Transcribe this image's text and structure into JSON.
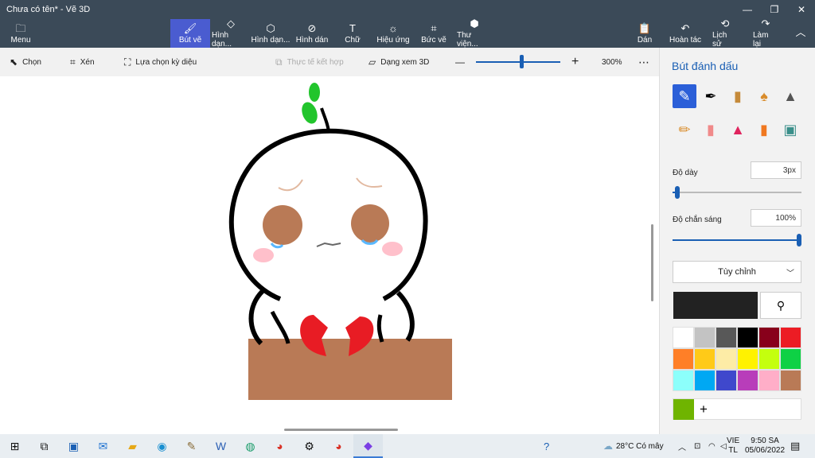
{
  "window": {
    "title": "Chưa có tên* - Vẽ 3D",
    "controls": {
      "minimize": "—",
      "restore": "❐",
      "close": "✕"
    }
  },
  "ribbon": {
    "menu": {
      "label": "Menu",
      "icon": "folder-icon"
    },
    "tabs": [
      {
        "label": "Bút vẽ",
        "icon": "brush-icon",
        "active": true
      },
      {
        "label": "Hình dạn...",
        "icon": "shapes2d-icon"
      },
      {
        "label": "Hình dạn...",
        "icon": "shapes3d-icon"
      },
      {
        "label": "Hình dán",
        "icon": "sticker-icon"
      },
      {
        "label": "Chữ",
        "icon": "text-icon"
      },
      {
        "label": "Hiệu ứng",
        "icon": "effects-icon"
      },
      {
        "label": "Bức vẽ",
        "icon": "canvas-icon"
      },
      {
        "label": "Thư viện...",
        "icon": "library-icon"
      }
    ],
    "right": [
      {
        "label": "Dán",
        "icon": "paste-icon"
      },
      {
        "label": "Hoàn tác",
        "icon": "undo-icon"
      },
      {
        "label": "Lịch sử",
        "icon": "history-icon"
      },
      {
        "label": "Làm lại",
        "icon": "redo-icon"
      }
    ],
    "collapse_icon": "chevron-up-icon"
  },
  "subbar": {
    "select": "Chọn",
    "crop": "Xén",
    "magic_select": "Lựa chọn kỳ diệu",
    "mixed_reality": "Thực tế kết hợp",
    "view3d": "Dạng xem 3D",
    "zoom_minus": "—",
    "zoom_plus": "+",
    "zoom": "300%",
    "more": "⋯",
    "zoom_level": 0.54
  },
  "panel": {
    "title": "Bút đánh dấu",
    "brushes": [
      "marker-icon",
      "calligraphy-pen-icon",
      "oil-brush-icon",
      "watercolor-icon",
      "pixel-pen-icon",
      "pencil-icon",
      "eraser-icon",
      "crayon-icon",
      "spray-can-icon",
      "fill-icon"
    ],
    "thickness_label": "Độ dày",
    "thickness_value": "3px",
    "thickness_level": 0.04,
    "opacity_label": "Độ chắn sáng",
    "opacity_value": "100%",
    "opacity_level": 1.0,
    "finish": "Tùy chỉnh",
    "current_color": "#222222",
    "palette": [
      "#ffffff",
      "#c3c3c3",
      "#585858",
      "#000000",
      "#88001b",
      "#ec1c24",
      "#ff7f27",
      "#ffca18",
      "#fdeca6",
      "#fff200",
      "#c4ff0e",
      "#0ed145",
      "#8cfffb",
      "#00a8f3",
      "#3f48cc",
      "#b83dba",
      "#ffaec8",
      "#b97a56"
    ],
    "custom_color": "#6fb400",
    "add_label": "+"
  },
  "taskbar": {
    "apps": [
      "windows-start-icon",
      "task-view-icon",
      "zalo-icon",
      "mail-icon",
      "file-explorer-icon",
      "edge-icon",
      "paint-icon",
      "word-icon",
      "app-icon",
      "chrome-icon",
      "settings-icon",
      "chrome-profile-icon",
      "paint3d-icon"
    ],
    "weather": "28°C  Có mây",
    "lang_top": "VIE",
    "lang_bottom": "TL",
    "time": "9:50 SA",
    "date": "05/06/2022"
  }
}
